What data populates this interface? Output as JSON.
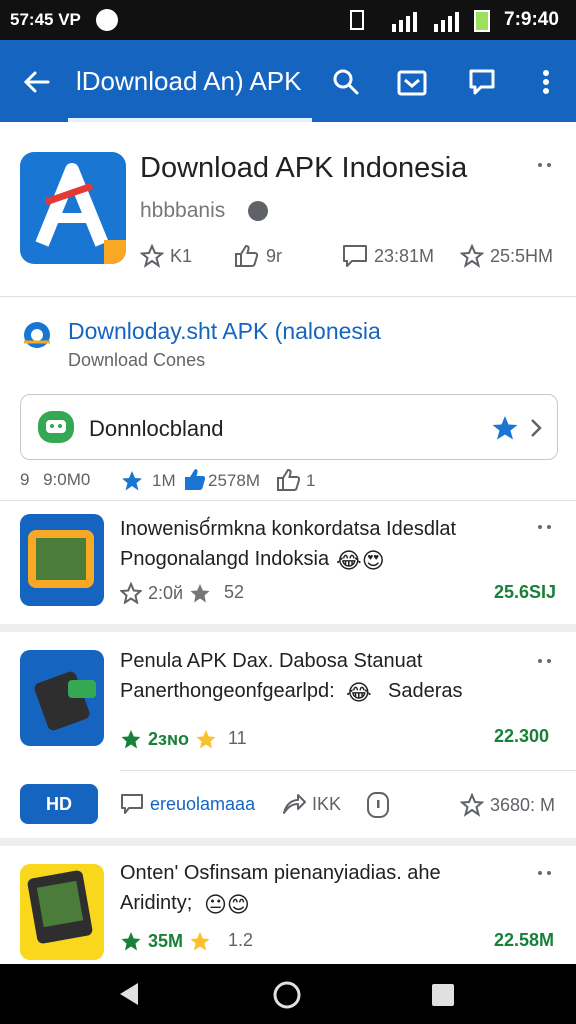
{
  "status": {
    "left": "57:45 VP",
    "time": "7:9:40"
  },
  "appbar": {
    "title": "lDownload An) APK"
  },
  "app": {
    "name": "Download APK Indonesia",
    "developer": "hbbbanis",
    "stats": {
      "rating": "K1",
      "likes": "9r",
      "reviews": "23:81M",
      "downloads": "25:5HM"
    }
  },
  "promo": {
    "title": "Downloday.sht APK (nalonesia",
    "subtitle": "Download Cones"
  },
  "search": {
    "value": "Donnlocbland"
  },
  "summary": {
    "a": "9    9:0M0",
    "b": "1M",
    "c": "2578M",
    "d": "1"
  },
  "items": [
    {
      "line1": "Inowenisб́rmkna konkordatsa Idesdlat",
      "line2": "Pnogonalangd Indoksia",
      "rating": "2:0й",
      "count": "52",
      "size": "25.6SIJ"
    },
    {
      "line1": "Penula APK Dax. Dabosa Stanuat",
      "line2": "Panerthongeonfgearlpd:",
      "line2b": "Saderas",
      "rating": "2ɜɴo",
      "count": "11",
      "size": "22.300"
    },
    {
      "line1": "Onten' Osfinsam pienanyiadias. ahe",
      "line2": "Aridinty;",
      "rating": "35M",
      "count": "1.2",
      "size": "22.58M"
    }
  ],
  "actionrow": {
    "button": "HD",
    "label": "ereuolamaaa",
    "share": "IKK",
    "size": "3680: M"
  }
}
